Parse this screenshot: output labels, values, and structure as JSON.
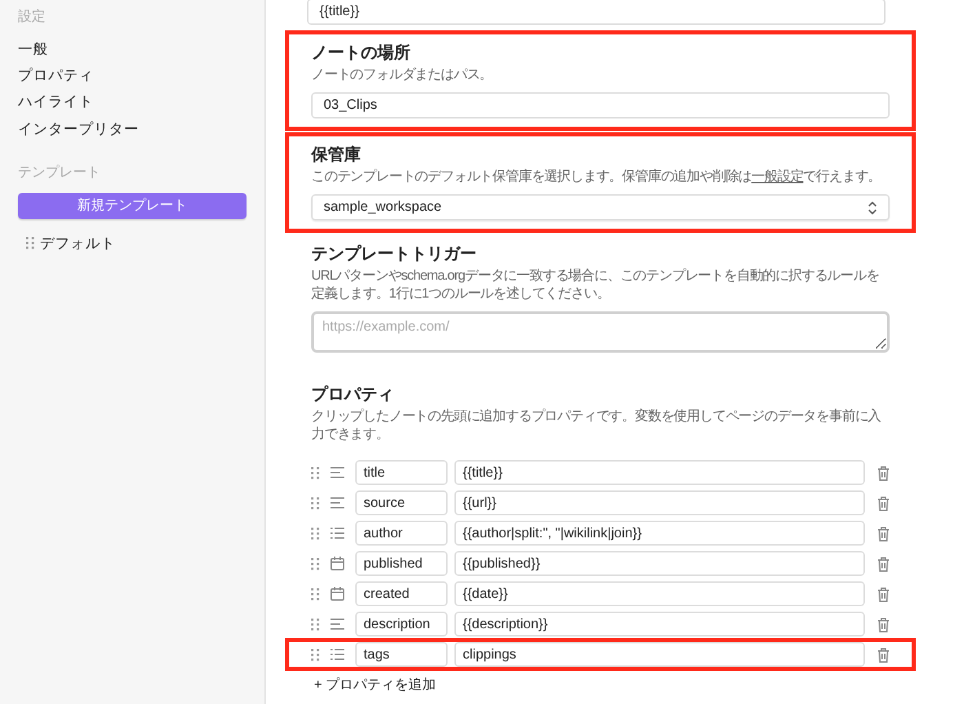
{
  "sidebar": {
    "settings_heading": "設定",
    "items": [
      {
        "label": "一般"
      },
      {
        "label": "プロパティ"
      },
      {
        "label": "ハイライト"
      },
      {
        "label": "インタープリター"
      }
    ],
    "templates_heading": "テンプレート",
    "new_template_button": "新規テンプレート",
    "templates": [
      {
        "label": "デフォルト"
      }
    ]
  },
  "main": {
    "top_field": {
      "value": "{{title}}"
    },
    "note_location": {
      "title": "ノートの場所",
      "description": "ノートのフォルダまたはパス。",
      "value": "03_Clips",
      "highlighted": true
    },
    "vault": {
      "title": "保管庫",
      "description_before": "このテンプレートのデフォルト保管庫を選択します。保管庫の追加や削除は",
      "description_link": "一般設定",
      "description_after": "で行えます。",
      "value": "sample_workspace",
      "highlighted": true
    },
    "trigger": {
      "title": "テンプレートトリガー",
      "description": "URLパターンやschema.orgデータに一致する場合に、このテンプレートを自動的に択するルールを定義します。1行に1つのルールを述してください。",
      "placeholder": "https://example.com/"
    },
    "properties": {
      "title": "プロパティ",
      "description": "クリップしたノートの先頭に追加するプロパティです。変数を使用してページのデータを事前に入力できます。",
      "rows": [
        {
          "kind": "text",
          "name": "title",
          "value": "{{title}}",
          "highlighted": false
        },
        {
          "kind": "text",
          "name": "source",
          "value": "{{url}}",
          "highlighted": false
        },
        {
          "kind": "list",
          "name": "author",
          "value": "{{author|split:\", \"|wikilink|join}}",
          "highlighted": false
        },
        {
          "kind": "date",
          "name": "published",
          "value": "{{published}}",
          "highlighted": false
        },
        {
          "kind": "date",
          "name": "created",
          "value": "{{date}}",
          "highlighted": false
        },
        {
          "kind": "text",
          "name": "description",
          "value": "{{description}}",
          "highlighted": false
        },
        {
          "kind": "list",
          "name": "tags",
          "value": "clippings",
          "highlighted": true
        }
      ],
      "add_button": "+ プロパティを追加"
    }
  }
}
